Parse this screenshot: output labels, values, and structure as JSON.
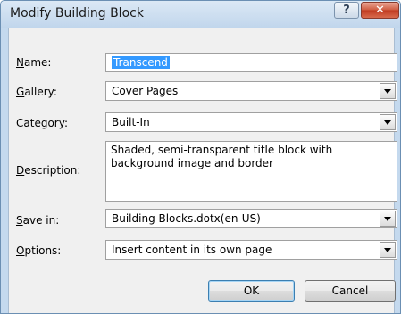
{
  "window": {
    "title": "Modify Building Block",
    "help_label": "?",
    "close_label": "✕"
  },
  "form": {
    "name": {
      "label_key": "N",
      "label_rest": "ame:",
      "value": "Transcend"
    },
    "gallery": {
      "label_key": "G",
      "label_rest": "allery:",
      "value": "Cover Pages"
    },
    "category": {
      "label_key": "C",
      "label_rest": "ategory:",
      "value": "Built-In"
    },
    "description": {
      "label_key": "D",
      "label_rest": "escription:",
      "value": "Shaded, semi-transparent title block with background image and border"
    },
    "save_in": {
      "label_key": "S",
      "label_rest": "ave in:",
      "value": "Building Blocks.dotx(en-US)"
    },
    "options": {
      "label_key": "O",
      "label_rest": "ptions:",
      "value": "Insert content in its own page"
    }
  },
  "buttons": {
    "ok_label": "OK",
    "cancel_label": "Cancel"
  },
  "icons": {
    "help": "help-icon",
    "close": "close-icon",
    "dropdown": "chevron-down-icon"
  },
  "colors": {
    "title_bar": "#c4d9ee",
    "selection": "#3399ff",
    "close_button": "#c94a2e",
    "dialog_background": "#f0f0f0"
  }
}
